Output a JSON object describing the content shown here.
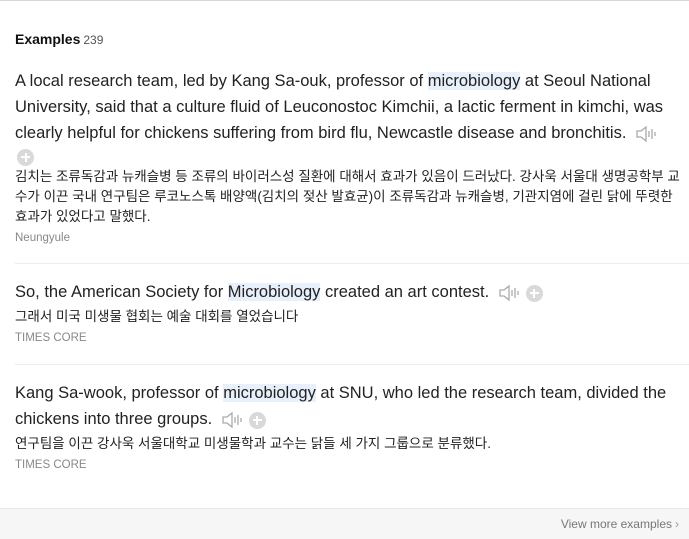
{
  "header": {
    "title": "Examples",
    "count": "239"
  },
  "examples": [
    {
      "en_before": "A local research team, led by Kang Sa-ouk, professor of ",
      "en_highlight": "microbiology",
      "en_after": " at Seoul National University, said that a culture fluid of Leuconostoc Kimchii, a lactic ferment in kimchi, was clearly helpful for chickens suffering from bird flu, Newcastle disease and bronchitis.",
      "ko": "김치는 조류독감과 뉴캐슬병 등 조류의 바이러스성 질환에 대해서 효과가 있음이 드러났다. 강사욱 서울대 생명공학부 교수가 이끈 국내 연구팀은 루코노스톡 배양액(김치의 젖산 발효균)이 조류독감과 뉴캐슬병, 기관지염에 걸린 닭에 뚜렷한 효과가 있었다고 말했다.",
      "source": "Neungyule"
    },
    {
      "en_before": "So, the American Society for ",
      "en_highlight": "Microbiology",
      "en_after": " created an art contest.",
      "ko": "그래서 미국 미생물 협회는 예술 대회를 열었습니다",
      "source": "TIMES CORE"
    },
    {
      "en_before": "Kang Sa-wook, professor of ",
      "en_highlight": "microbiology",
      "en_after": " at SNU, who led the research team, divided the chickens into three groups.",
      "ko": "연구팀을 이끈 강사욱 서울대학교 미생물학과 교수는 닭들 세 가지 그룹으로 분류했다.",
      "source": "TIMES CORE"
    }
  ],
  "footer": {
    "view_more": "View more examples"
  },
  "icons": {
    "speaker": "speaker-icon",
    "add": "plus-circle-icon",
    "chevron": "chevron-right-icon"
  }
}
